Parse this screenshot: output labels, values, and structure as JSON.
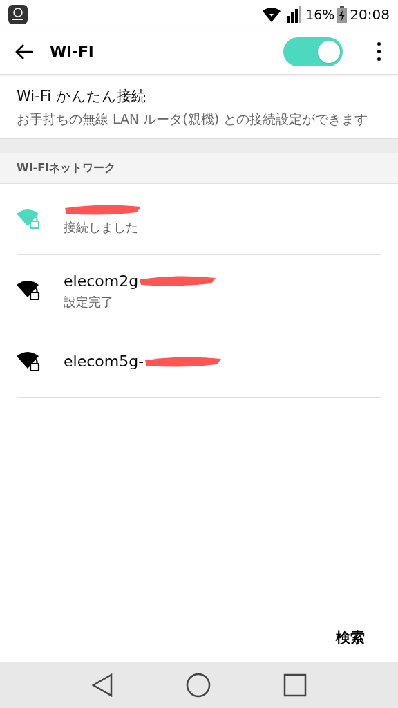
{
  "status_bar": {
    "battery": "16%",
    "time": "20:08"
  },
  "toolbar": {
    "title": "Wi-Fi",
    "on": true
  },
  "easy_connect": {
    "title": "Wi-Fi かんたん接続",
    "description": "お手持ちの無線 LAN ルータ(親機) との接続設定ができます"
  },
  "section_header": "WI-FIネットワーク",
  "networks": [
    {
      "status": "接続しました",
      "connected": true,
      "redacted": true
    },
    {
      "name": "elecom2g",
      "status": "設定完了",
      "connected": false,
      "redacted": true
    },
    {
      "name": "elecom5g-",
      "connected": false,
      "redacted": true
    }
  ],
  "bottom_action": "検索"
}
